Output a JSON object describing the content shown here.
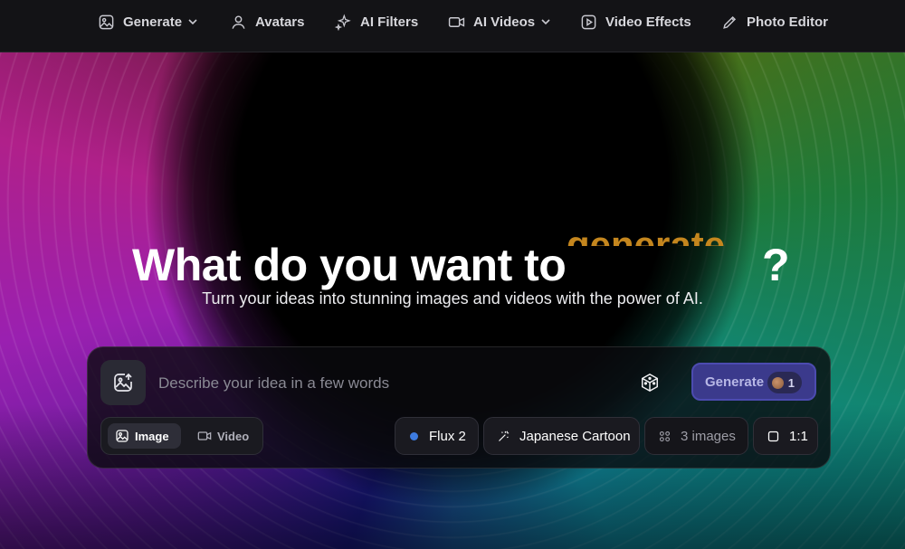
{
  "nav": {
    "items": [
      {
        "label": "Generate",
        "icon": "image-icon",
        "dropdown": true
      },
      {
        "label": "Avatars",
        "icon": "user-icon",
        "dropdown": false
      },
      {
        "label": "AI Filters",
        "icon": "sparkles-icon",
        "dropdown": false
      },
      {
        "label": "AI Videos",
        "icon": "video-icon",
        "dropdown": true
      },
      {
        "label": "Video Effects",
        "icon": "play-square-icon",
        "dropdown": false
      },
      {
        "label": "Photo Editor",
        "icon": "pencil-icon",
        "dropdown": false
      }
    ]
  },
  "hero": {
    "headline": "What do you want to",
    "rotating_word": "generate",
    "question_mark": "?",
    "subtitle": "Turn your ideas into stunning images and videos with the power of AI."
  },
  "prompt": {
    "placeholder": "Describe your idea in a few words",
    "value": "",
    "generate_label": "Generate",
    "credits": "1",
    "modes": [
      {
        "label": "Image",
        "active": true
      },
      {
        "label": "Video",
        "active": false
      }
    ],
    "model": "Flux 2",
    "style": "Japanese Cartoon",
    "count": "3 images",
    "ratio": "1:1"
  },
  "colors": {
    "accent": "#3b3a8c",
    "rotating_word": "#c4861e",
    "model_dot": "#3d7be0"
  }
}
